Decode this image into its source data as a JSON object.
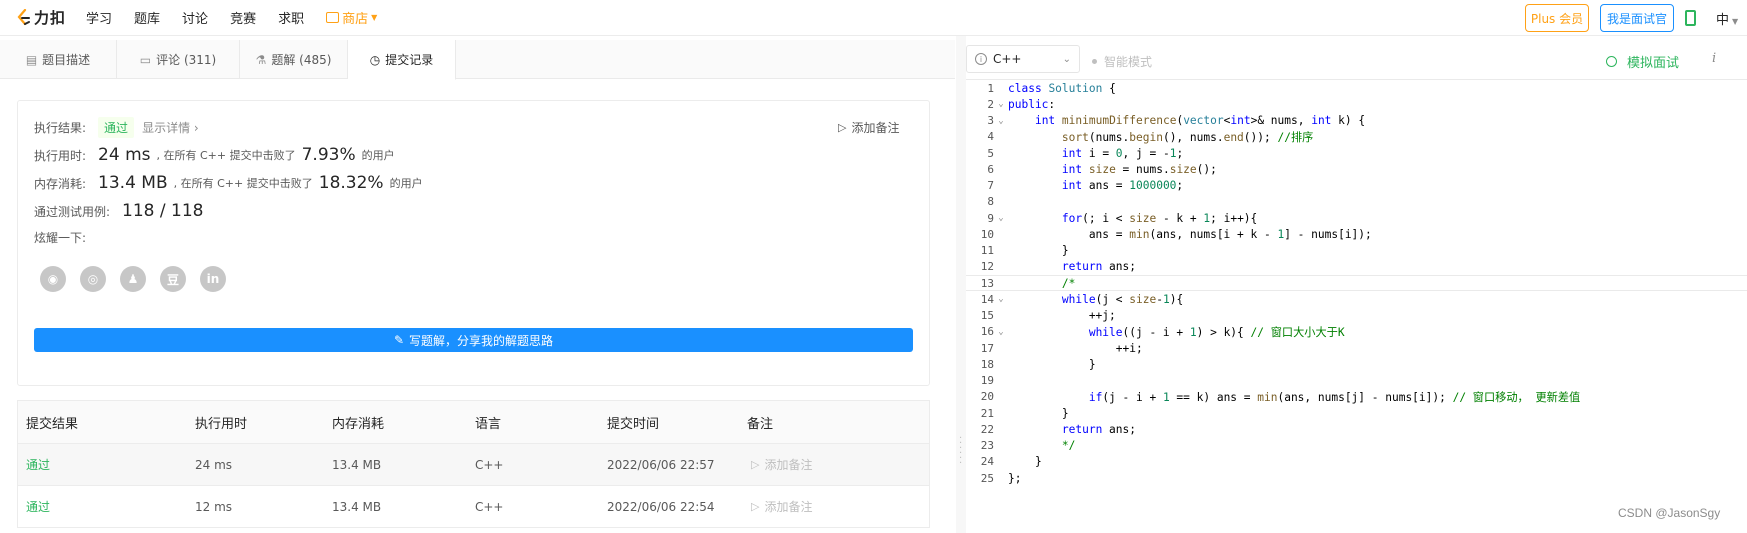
{
  "nav": {
    "logo_text": "力扣",
    "links": [
      "学习",
      "题库",
      "讨论",
      "竞赛",
      "求职"
    ],
    "store_label": "商店",
    "plus_label": "Plus 会员",
    "interviewer_label": "我是面试官",
    "lang_label": "中"
  },
  "tabs": [
    {
      "label": "题目描述",
      "icon": "doc-icon"
    },
    {
      "label": "评论 (311)",
      "icon": "comment-icon"
    },
    {
      "label": "题解 (485)",
      "icon": "flask-icon"
    },
    {
      "label": "提交记录",
      "icon": "clock-icon"
    }
  ],
  "result": {
    "status_label": "执行结果:",
    "status_value": "通过",
    "detail_link": "显示详情 ›",
    "add_note": "添加备注",
    "time_label": "执行用时:",
    "time_value": "24 ms",
    "time_beat_text": ", 在所有 C++ 提交中击败了",
    "time_pct": "7.93%",
    "users_text": "的用户",
    "mem_label": "内存消耗:",
    "mem_value": "13.4 MB",
    "mem_beat_text": ", 在所有 C++ 提交中击败了",
    "mem_pct": "18.32%",
    "cases_label": "通过测试用例:",
    "cases_value": "118 / 118",
    "share_label": "炫耀一下:",
    "share_icons": [
      "wechat-icon",
      "weibo-icon",
      "qq-icon",
      "douban-icon",
      "linkedin-icon"
    ],
    "write_button": "写题解，分享我的解题思路"
  },
  "table": {
    "headers": [
      "提交结果",
      "执行用时",
      "内存消耗",
      "语言",
      "提交时间",
      "备注"
    ],
    "rows": [
      {
        "result": "通过",
        "time": "24 ms",
        "mem": "13.4 MB",
        "lang": "C++",
        "date": "2022/06/06 22:57",
        "note": "添加备注"
      },
      {
        "result": "通过",
        "time": "12 ms",
        "mem": "13.4 MB",
        "lang": "C++",
        "date": "2022/06/06 22:54",
        "note": "添加备注"
      }
    ]
  },
  "editor": {
    "language": "C++",
    "smart_mode": "智能模式",
    "mock_interview": "模拟面试",
    "more": "i",
    "current_line": 13,
    "lines": [
      "class Solution {",
      "public:",
      "    int minimumDifference(vector<int>& nums, int k) {",
      "        sort(nums.begin(), nums.end()); //排序",
      "        int i = 0, j = -1;",
      "        int size = nums.size();",
      "        int ans = 1000000;",
      "",
      "        for(; i < size - k + 1; i++){",
      "            ans = min(ans, nums[i + k - 1] - nums[i]);",
      "        }",
      "        return ans;",
      "        /*",
      "        while(j < size-1){",
      "            ++j;",
      "            while((j - i + 1) > k){ // 窗口大小大于K",
      "                ++i;",
      "            }",
      "",
      "            if(j - i + 1 == k) ans = min(ans, nums[j] - nums[i]); // 窗口移动， 更新差值",
      "        }",
      "        return ans;",
      "        */",
      "    }",
      "};"
    ],
    "fold_lines": [
      2,
      3,
      9,
      14,
      16
    ]
  },
  "watermark": "CSDN @JasonSgy"
}
